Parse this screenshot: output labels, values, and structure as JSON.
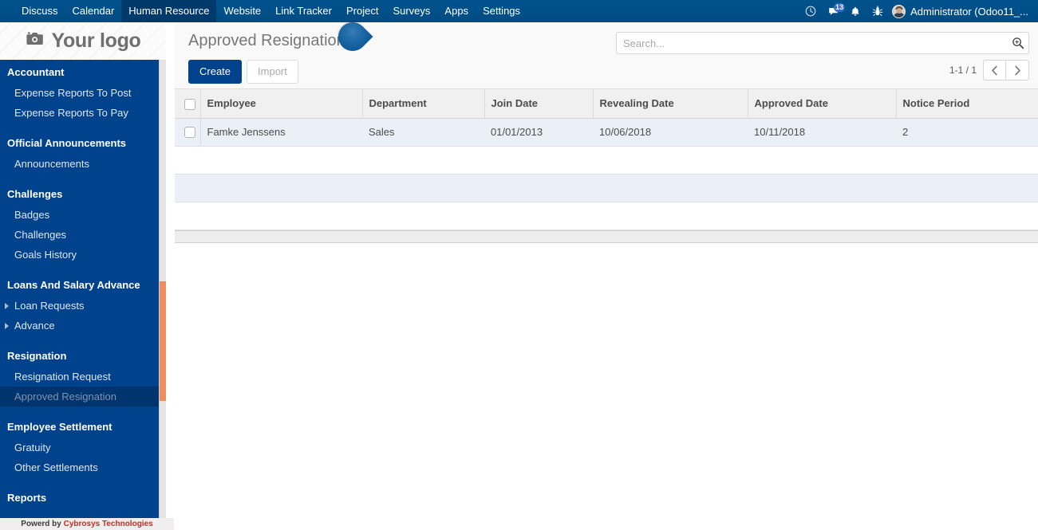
{
  "navbar": {
    "menus": [
      {
        "label": "Discuss",
        "active": false
      },
      {
        "label": "Calendar",
        "active": false
      },
      {
        "label": "Human Resource",
        "active": true
      },
      {
        "label": "Website",
        "active": false
      },
      {
        "label": "Link Tracker",
        "active": false
      },
      {
        "label": "Project",
        "active": false
      },
      {
        "label": "Surveys",
        "active": false
      },
      {
        "label": "Apps",
        "active": false
      },
      {
        "label": "Settings",
        "active": false
      }
    ],
    "icons": [
      {
        "name": "clock-icon"
      },
      {
        "name": "messages-icon",
        "badge": "13"
      },
      {
        "name": "bell-icon"
      },
      {
        "name": "bug-icon"
      }
    ],
    "messages_count": "13",
    "user": "Administrator (Odoo11_..."
  },
  "sidebar": {
    "logo_text": "Your logo",
    "groups": [
      {
        "header": "Accountant",
        "items": [
          {
            "label": "Expense Reports To Post",
            "caret": false,
            "selected": false
          },
          {
            "label": "Expense Reports To Pay",
            "caret": false,
            "selected": false
          }
        ]
      },
      {
        "header": "Official Announcements",
        "items": [
          {
            "label": "Announcements",
            "caret": false,
            "selected": false
          }
        ]
      },
      {
        "header": "Challenges",
        "items": [
          {
            "label": "Badges",
            "caret": false,
            "selected": false
          },
          {
            "label": "Challenges",
            "caret": false,
            "selected": false
          },
          {
            "label": "Goals History",
            "caret": false,
            "selected": false
          }
        ]
      },
      {
        "header": "Loans And Salary Advance",
        "items": [
          {
            "label": "Loan Requests",
            "caret": true,
            "selected": false
          },
          {
            "label": "Advance",
            "caret": true,
            "selected": false
          }
        ]
      },
      {
        "header": "Resignation",
        "items": [
          {
            "label": "Resignation Request",
            "caret": false,
            "selected": false
          },
          {
            "label": "Approved Resignation",
            "caret": false,
            "selected": true
          }
        ]
      },
      {
        "header": "Employee Settlement",
        "items": [
          {
            "label": "Gratuity",
            "caret": false,
            "selected": false
          },
          {
            "label": "Other Settlements",
            "caret": false,
            "selected": false
          }
        ]
      },
      {
        "header": "Reports",
        "items": []
      }
    ],
    "footer_prefix": "Powerd by ",
    "footer_brand": "Cybrosys Technologies"
  },
  "control_panel": {
    "title": "Approved Resignation",
    "create_label": "Create",
    "import_label": "Import",
    "search_placeholder": "Search...",
    "search_value": "",
    "pager_count": "1-1 / 1"
  },
  "list": {
    "columns": [
      "Employee",
      "Department",
      "Join Date",
      "Revealing Date",
      "Approved Date",
      "Notice Period"
    ],
    "rows": [
      {
        "employee": "Famke Jenssens",
        "department": "Sales",
        "join_date": "01/01/2013",
        "revealing_date": "10/06/2018",
        "approved_date": "10/11/2018",
        "notice_period": "2"
      }
    ]
  },
  "colors": {
    "navbar_blue": "#00528c",
    "sidebar_blue": "#00428c",
    "sidebar_selected": "#00346f",
    "primary_button": "#00428c",
    "row_highlight": "#eaeff8",
    "scrollbar_thumb": "#ef8d62",
    "brand_red": "#cf2a2a"
  }
}
